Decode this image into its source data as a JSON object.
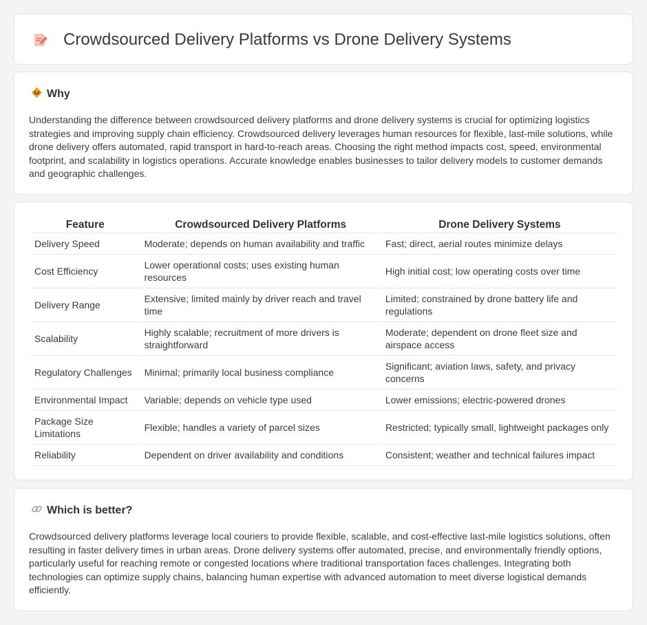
{
  "header": {
    "title": "Crowdsourced Delivery Platforms vs Drone Delivery Systems",
    "icon": "document-edit-icon"
  },
  "why": {
    "title": "Why",
    "icon": "diamond-sign-icon",
    "body": "Understanding the difference between crowdsourced delivery platforms and drone delivery systems is crucial for optimizing logistics strategies and improving supply chain efficiency. Crowdsourced delivery leverages human resources for flexible, last-mile solutions, while drone delivery offers automated, rapid transport in hard-to-reach areas. Choosing the right method impacts cost, speed, environmental footprint, and scalability in logistics operations. Accurate knowledge enables businesses to tailor delivery models to customer demands and geographic challenges."
  },
  "table": {
    "headers": [
      "Feature",
      "Crowdsourced Delivery Platforms",
      "Drone Delivery Systems"
    ],
    "rows": [
      [
        "Delivery Speed",
        "Moderate; depends on human availability and traffic",
        "Fast; direct, aerial routes minimize delays"
      ],
      [
        "Cost Efficiency",
        "Lower operational costs; uses existing human resources",
        "High initial cost; low operating costs over time"
      ],
      [
        "Delivery Range",
        "Extensive; limited mainly by driver reach and travel time",
        "Limited; constrained by drone battery life and regulations"
      ],
      [
        "Scalability",
        "Highly scalable; recruitment of more drivers is straightforward",
        "Moderate; dependent on drone fleet size and airspace access"
      ],
      [
        "Regulatory Challenges",
        "Minimal; primarily local business compliance",
        "Significant; aviation laws, safety, and privacy concerns"
      ],
      [
        "Environmental Impact",
        "Variable; depends on vehicle type used",
        "Lower emissions; electric-powered drones"
      ],
      [
        "Package Size Limitations",
        "Flexible; handles a variety of parcel sizes",
        "Restricted; typically small, lightweight packages only"
      ],
      [
        "Reliability",
        "Dependent on driver availability and conditions",
        "Consistent; weather and technical failures impact"
      ]
    ]
  },
  "better": {
    "title": "Which is better?",
    "icon": "link-icon",
    "body": "Crowdsourced delivery platforms leverage local couriers to provide flexible, scalable, and cost-effective last-mile logistics solutions, often resulting in faster delivery times in urban areas. Drone delivery systems offer automated, precise, and environmentally friendly options, particularly useful for reaching remote or congested locations where traditional transportation faces challenges. Integrating both technologies can optimize supply chains, balancing human expertise with advanced automation to meet diverse logistical demands efficiently."
  }
}
